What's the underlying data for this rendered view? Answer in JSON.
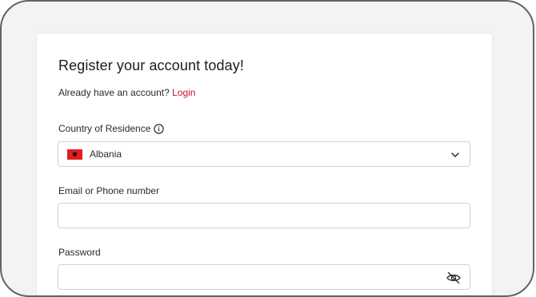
{
  "form": {
    "title": "Register your account today!",
    "login_prompt": "Already have an account?",
    "login_link": "Login",
    "country": {
      "label": "Country of Residence",
      "label_icon": "info-icon",
      "selected": "Albania",
      "flag_icon": "albania-flag-icon",
      "dropdown_icon": "chevron-down-icon"
    },
    "email": {
      "label": "Email or Phone number",
      "value": "",
      "placeholder": ""
    },
    "password": {
      "label": "Password",
      "value": "",
      "toggle_icon": "eye-off-icon"
    }
  },
  "colors": {
    "link": "#c41230",
    "background": "#f3f3f4",
    "card": "#ffffff",
    "border": "#cfd2d6",
    "flag_red": "#e41e20"
  }
}
